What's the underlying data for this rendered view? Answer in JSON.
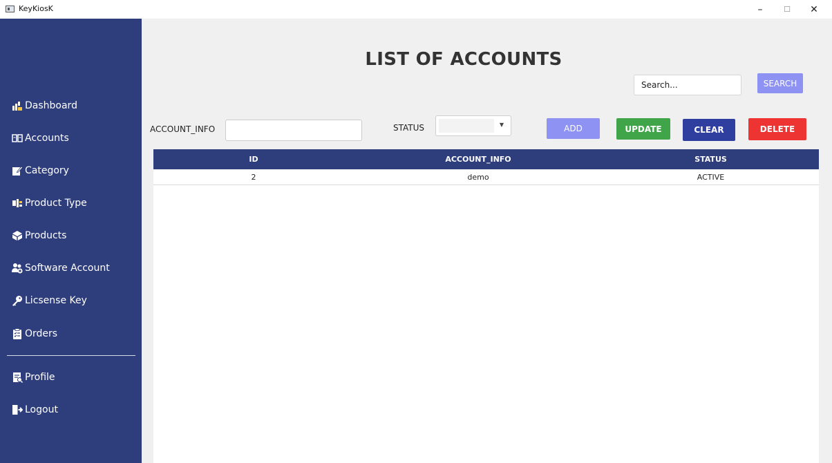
{
  "window": {
    "title": "KeyKiosK",
    "minimize": "–",
    "maximize": "☐",
    "close": "✕"
  },
  "sidebar": {
    "items": [
      {
        "label": "Dashboard",
        "icon": "dashboard-icon"
      },
      {
        "label": "Accounts",
        "icon": "accounts-icon"
      },
      {
        "label": "Category",
        "icon": "category-icon"
      },
      {
        "label": "Product Type",
        "icon": "product-type-icon"
      },
      {
        "label": "Products",
        "icon": "products-icon"
      },
      {
        "label": "Software Account",
        "icon": "software-account-icon"
      },
      {
        "label": "Licsense Key",
        "icon": "key-icon"
      },
      {
        "label": "Orders",
        "icon": "orders-icon"
      }
    ],
    "bottom_items": [
      {
        "label": "Profile",
        "icon": "profile-icon"
      },
      {
        "label": "Logout",
        "icon": "logout-icon"
      }
    ]
  },
  "main": {
    "title": "LIST OF ACCOUNTS",
    "search": {
      "placeholder": "Search...",
      "button": "SEARCH"
    },
    "form": {
      "account_info_label": "ACCOUNT_INFO",
      "account_info_value": "",
      "status_label": "STATUS",
      "status_value": ""
    },
    "buttons": {
      "add": "ADD",
      "update": "UPDATE",
      "clear": "CLEAR",
      "delete": "DELETE"
    },
    "table": {
      "columns": [
        "ID",
        "ACCOUNT_INFO",
        "STATUS"
      ],
      "rows": [
        [
          "2",
          "demo",
          "ACTIVE"
        ]
      ]
    }
  },
  "colors": {
    "sidebar": "#2e3d7b",
    "table_header": "#2e3d7b",
    "add_search": "#8e92f2",
    "update": "#3fa548",
    "clear": "#2e3fa0",
    "delete": "#ee3333"
  }
}
